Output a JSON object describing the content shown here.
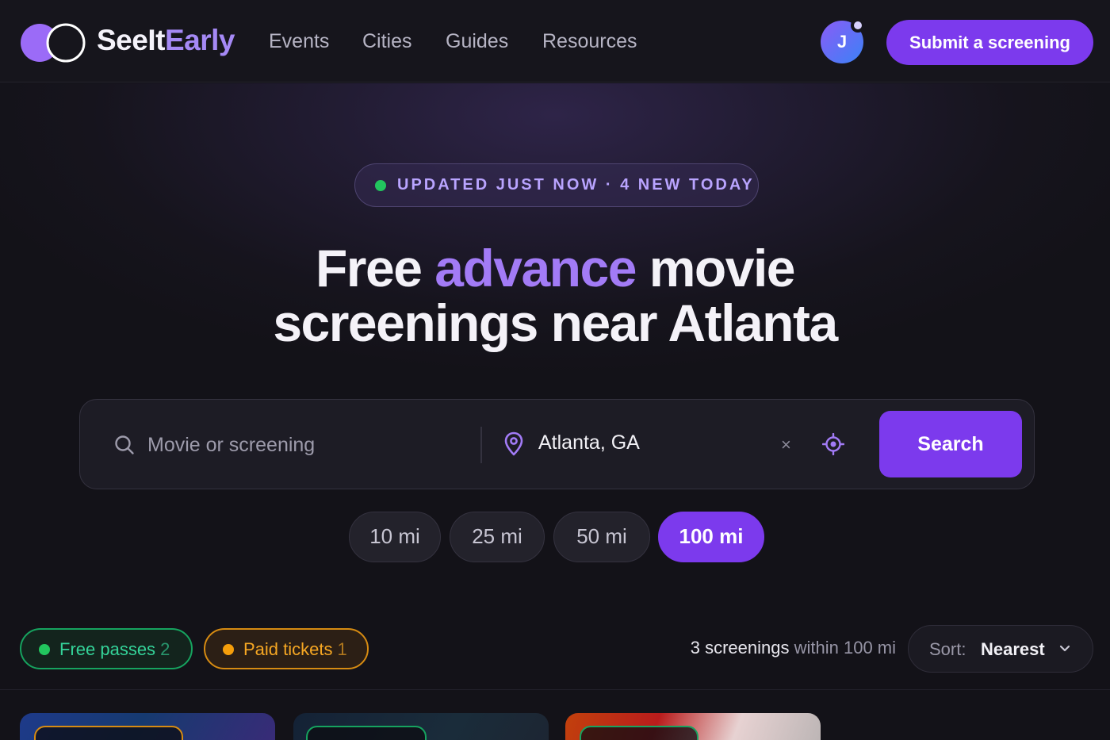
{
  "header": {
    "brand_part1": "SeeIt",
    "brand_part2": "Early",
    "nav": [
      "Events",
      "Cities",
      "Guides",
      "Resources"
    ],
    "avatar_initial": "J",
    "submit_label": "Submit a screening"
  },
  "hero": {
    "status_text": "UPDATED JUST NOW · 4 NEW TODAY",
    "headline_part1": "Free ",
    "headline_accent": "advance",
    "headline_part2": " movie",
    "headline_line2": "screenings near Atlanta"
  },
  "search": {
    "query_placeholder": "Movie or screening",
    "location_value": "Atlanta, GA",
    "clear_symbol": "×",
    "button_label": "Search"
  },
  "radius_options": [
    {
      "label": "10 mi",
      "active": false
    },
    {
      "label": "25 mi",
      "active": false
    },
    {
      "label": "50 mi",
      "active": false
    },
    {
      "label": "100 mi",
      "active": true
    }
  ],
  "filters": {
    "free": {
      "label": "Free passes",
      "count": "2",
      "color": "#34d399"
    },
    "paid": {
      "label": "Paid tickets",
      "count": "1",
      "color": "#f6a723"
    }
  },
  "results": {
    "count_text": "3 screenings",
    "within_text": "within 100 mi"
  },
  "sort": {
    "label": "Sort:",
    "value": "Nearest"
  },
  "colors": {
    "accent": "#7c3aed",
    "accent_text": "#a27bf6",
    "background": "#131218"
  },
  "icons": [
    "logo-icon",
    "search-icon",
    "location-pin-icon",
    "clear-icon",
    "locate-me-icon",
    "chevron-down-icon"
  ]
}
